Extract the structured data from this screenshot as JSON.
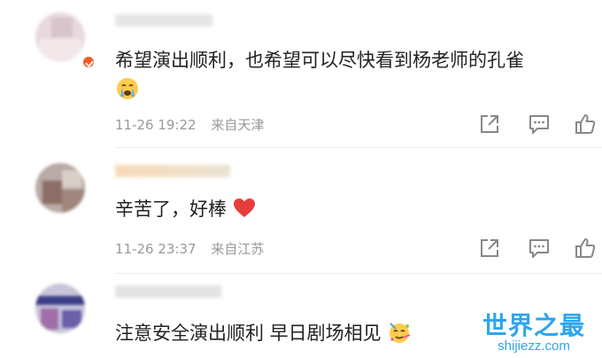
{
  "comments": [
    {
      "text": "希望演出顺利，也希望可以尽快看到杨老师的孔雀",
      "emoji": "crying-face",
      "time": "11-26 19:22",
      "location": "来自天津"
    },
    {
      "text": "辛苦了，好棒",
      "emoji": "red-heart",
      "time": "11-26 23:37",
      "location": "来自江苏"
    },
    {
      "text": "注意安全演出顺利 早日剧场相见",
      "emoji": "party-face"
    }
  ],
  "watermark": {
    "title": "世界之最",
    "url": "shijiezz.com"
  },
  "colors": {
    "text": "#222222",
    "meta": "#999999",
    "icon": "#888888",
    "badge": "#f25c2a",
    "heart": "#e83c3c",
    "watermark": "#2da6ef"
  }
}
